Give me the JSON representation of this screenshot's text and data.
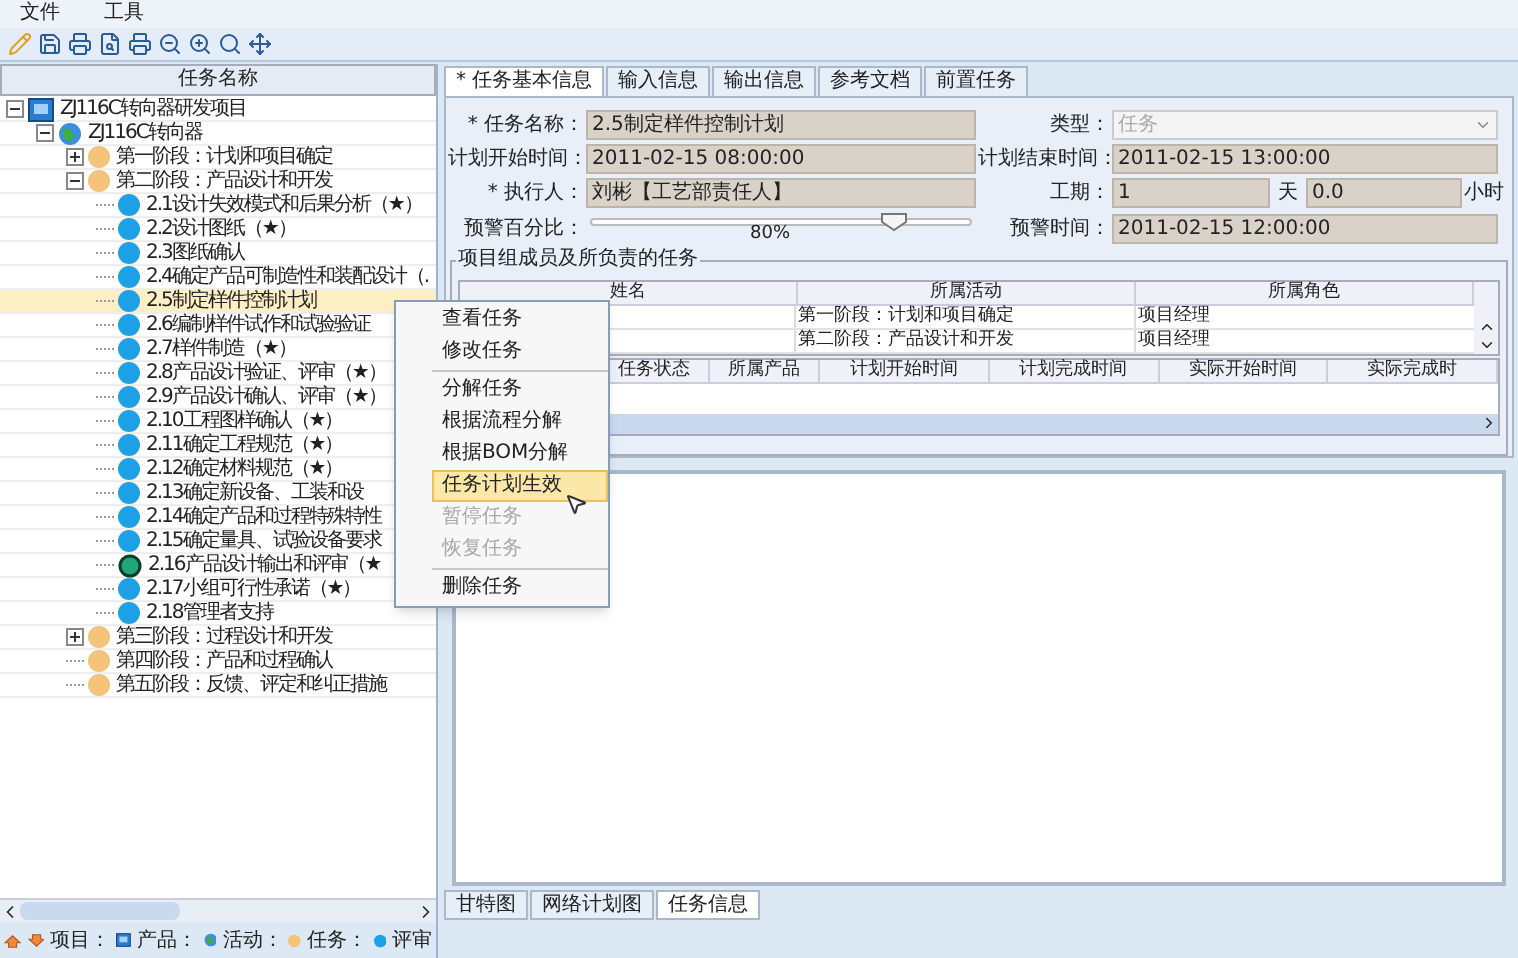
{
  "menu_bar": [
    "文件",
    "工具"
  ],
  "left_panel": {
    "header": "任务名称",
    "tree": [
      {
        "label": "ZJ116C转向器研发项目",
        "kind": "project",
        "expanded": true,
        "selected": false,
        "children": [
          {
            "label": "ZJ116C转向器",
            "kind": "product",
            "expanded": true,
            "selected": false,
            "children": [
              {
                "label": "第一阶段：计划和项目确定",
                "kind": "activity",
                "expanded": false,
                "selected": false
              },
              {
                "label": "第二阶段：产品设计和开发",
                "kind": "activity",
                "expanded": true,
                "selected": false,
                "children": [
                  {
                    "label": "2.1设计失效模式和后果分析（★）",
                    "kind": "task",
                    "selected": false
                  },
                  {
                    "label": "2.2设计图纸（★）",
                    "kind": "task",
                    "selected": false
                  },
                  {
                    "label": "2.3图纸确认",
                    "kind": "task",
                    "selected": false
                  },
                  {
                    "label": "2.4确定产品可制造性和装配设计（.",
                    "kind": "task",
                    "selected": false
                  },
                  {
                    "label": "2.5制定样件控制计划",
                    "kind": "task",
                    "selected": true
                  },
                  {
                    "label": "2.6编制样件试作和试验验证",
                    "kind": "task",
                    "selected": false
                  },
                  {
                    "label": "2.7样件制造（★）",
                    "kind": "task",
                    "selected": false
                  },
                  {
                    "label": "2.8产品设计验证、评审（★）",
                    "kind": "task",
                    "selected": false
                  },
                  {
                    "label": "2.9产品设计确认、评审（★）",
                    "kind": "task",
                    "selected": false
                  },
                  {
                    "label": "2.10工程图样确认（★）",
                    "kind": "task",
                    "selected": false
                  },
                  {
                    "label": "2.11确定工程规范（★）",
                    "kind": "task",
                    "selected": false
                  },
                  {
                    "label": "2.12确定材料规范（★）",
                    "kind": "task",
                    "selected": false
                  },
                  {
                    "label": "2.13确定新设备、工装和设",
                    "kind": "task",
                    "selected": false
                  },
                  {
                    "label": "2.14确定产品和过程特殊特性",
                    "kind": "task",
                    "selected": false
                  },
                  {
                    "label": "2.15确定量具、试验设备要求",
                    "kind": "task",
                    "selected": false
                  },
                  {
                    "label": "2.16产品设计输出和评审（★",
                    "kind": "review",
                    "selected": false
                  },
                  {
                    "label": "2.17小组可行性承诺（★）",
                    "kind": "task",
                    "selected": false
                  },
                  {
                    "label": "2.18管理者支持",
                    "kind": "task",
                    "selected": false
                  }
                ]
              },
              {
                "label": "第三阶段：过程设计和开发",
                "kind": "activity",
                "expanded": false,
                "selected": false
              },
              {
                "label": "第四阶段：产品和过程确认",
                "kind": "activity",
                "selected": false
              },
              {
                "label": "第五阶段：反馈、评定和纠正措施",
                "kind": "activity",
                "selected": false
              }
            ]
          }
        ]
      }
    ],
    "legend": [
      {
        "label": "项目：",
        "kind": "product"
      },
      {
        "label": "产品：",
        "kind": "activity"
      },
      {
        "label": "活动：",
        "kind": "phase"
      },
      {
        "label": "任务：",
        "kind": "task"
      },
      {
        "label": "评审",
        "kind": "none"
      }
    ]
  },
  "tabs": [
    {
      "label": "* 任务基本信息",
      "selected": true
    },
    {
      "label": "输入信息",
      "selected": false
    },
    {
      "label": "输出信息",
      "selected": false
    },
    {
      "label": "参考文档",
      "selected": false
    },
    {
      "label": "前置任务",
      "selected": false
    }
  ],
  "form": {
    "name": {
      "label": "* 任务名称：",
      "value": "2.5制定样件控制计划"
    },
    "type": {
      "label": "类型：",
      "value": "任务",
      "disabled": true
    },
    "start": {
      "label": "计划开始时间：",
      "value": "2011-02-15 08:00:00"
    },
    "end": {
      "label": "计划结束时间：",
      "value": "2011-02-15 13:00:00"
    },
    "executor": {
      "label": "* 执行人：",
      "value": "刘彬【工艺部责任人】"
    },
    "duration": {
      "label": "工期：",
      "days": "1",
      "day_unit": "天",
      "hours": "0.0",
      "hour_unit": "小时"
    },
    "warning_percent": {
      "label": "预警百分比：",
      "level": 0.8,
      "reading": "80%"
    },
    "warning_time": {
      "label": "预警时间：",
      "value": "2011-02-15 12:00:00"
    }
  },
  "members": {
    "title": "项目组成员及所负责的任务",
    "columns": [
      "姓名",
      "所属活动",
      "所属角色"
    ],
    "rows": [
      {
        "activity": "第一阶段：计划和项目确定",
        "role": "项目经理"
      },
      {
        "activity": "第二阶段：产品设计和开发",
        "role": "项目经理"
      }
    ]
  },
  "tasks_table": {
    "columns": [
      "任务状态",
      "所属产品",
      "计划开始时间",
      "计划完成时间",
      "实际开始时间",
      "实际完成时"
    ]
  },
  "context_menu": [
    {
      "label": "查看任务",
      "disabled": false,
      "selected": false
    },
    {
      "label": "修改任务",
      "disabled": false,
      "selected": false,
      "separator_after": true
    },
    {
      "label": "分解任务",
      "disabled": false,
      "selected": false
    },
    {
      "label": "根据流程分解",
      "disabled": false,
      "selected": false
    },
    {
      "label": "根据BOM分解",
      "disabled": false,
      "selected": false
    },
    {
      "label": "任务计划生效",
      "disabled": false,
      "selected": true
    },
    {
      "label": "暂停任务",
      "disabled": true,
      "selected": false
    },
    {
      "label": "恢复任务",
      "disabled": true,
      "selected": false,
      "separator_after": true
    },
    {
      "label": "删除任务",
      "disabled": false,
      "selected": false
    }
  ],
  "bottom_tabs": [
    {
      "label": "甘特图",
      "selected": false
    },
    {
      "label": "网络计划图",
      "selected": false
    },
    {
      "label": "任务信息",
      "selected": true
    }
  ]
}
